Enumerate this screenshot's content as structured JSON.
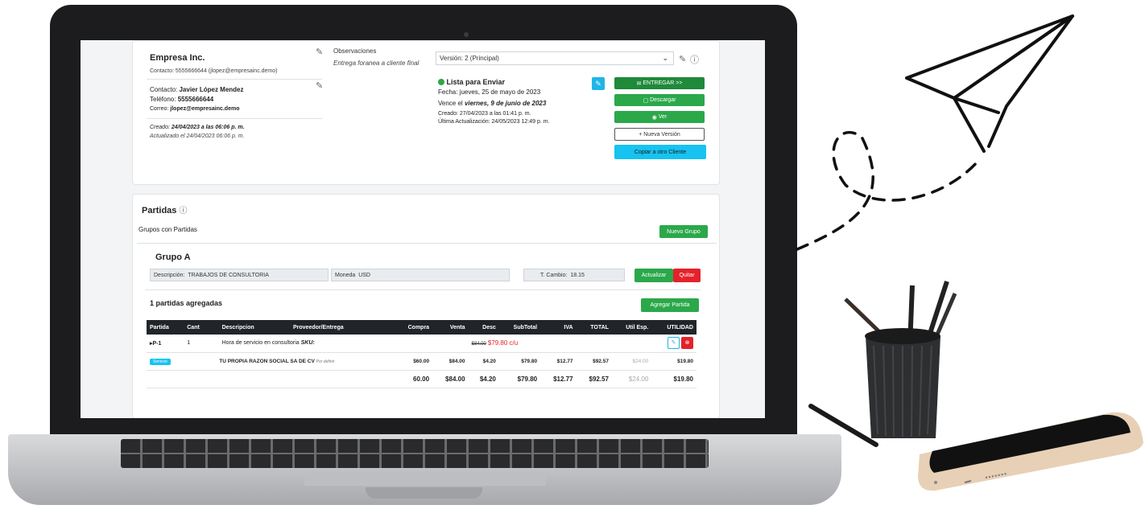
{
  "client": {
    "name": "Empresa Inc.",
    "contact_line": "Contacto: 5555666644 (jlopez@empresainc.demo)",
    "contact_label": "Contacto:",
    "contact_name": "Javier López Mendez",
    "phone_label": "Teléfono:",
    "phone": "5555666644",
    "email_label": "Correo:",
    "email": "jlopez@empresainc.demo",
    "created_prefix": "Creado:",
    "created": "24/04/2023 a las 06:06 p. m.",
    "updated": "Actualizado el 24/04/2023 06:06 p. m."
  },
  "observations": {
    "title": "Observaciones",
    "text": "Entrega foranea a cliente final"
  },
  "version": {
    "selected": "Versión: 2 (Principal)",
    "status": "Lista para Enviar",
    "date": "Fecha: jueves, 25 de mayo de 2023",
    "expires_prefix": "Vence el",
    "expires": "viernes, 9 de junio de 2023",
    "created": "Creado: 27/04/2023 a las 01:41 p. m.",
    "last_update": "Última Actualización: 24/05/2023 12:49 p. m.",
    "status_color": "#2ba84a"
  },
  "actions": {
    "deliver": "ENTREGAR >>",
    "download": "Descargar",
    "view": "Ver",
    "new_version": "Nueva Versión",
    "copy": "Copiar a otro Cliente"
  },
  "parts": {
    "title": "Partidas",
    "groups_label": "Grupos con Partidas",
    "new_group": "Nuevo Grupo",
    "group_name": "Grupo A",
    "desc_label": "Descripción:",
    "desc_value": "TRABAJOS DE CONSULTORIA",
    "currency_label": "Moneda",
    "currency_value": "USD",
    "rate_label": "T. Cambio:",
    "rate_value": "18.15",
    "update": "Actualizar",
    "remove": "Quitar",
    "count_label": "1 partidas agregadas",
    "add_part": "Agregar Partida"
  },
  "table": {
    "headers": [
      "Partida",
      "Cant",
      "Descripcion",
      "Proveedor/Entrega",
      "Compra",
      "Venta",
      "Desc",
      "SubTotal",
      "IVA",
      "TOTAL",
      "Util Esp.",
      "UTILIDAD"
    ],
    "row": {
      "id": "P-1",
      "qty": "1",
      "description": "Hora de servicio en consultoria",
      "sku": "SKU:",
      "old_price": "$84.00",
      "new_price": "$79.80 c/u"
    },
    "provider_row": {
      "badge": "Servicio",
      "provider": "TU PROPIA RAZON SOCIAL SA DE CV",
      "delivery": "Por definir",
      "compra": "$60.00",
      "venta": "$84.00",
      "desc": "$4.20",
      "subtotal": "$79.80",
      "iva": "$12.77",
      "total": "$92.57",
      "util_esp": "$24.00",
      "utilidad": "$19.80"
    },
    "totals": {
      "compra": "60.00",
      "venta": "$84.00",
      "desc": "$4.20",
      "subtotal": "$79.80",
      "iva": "$12.77",
      "total": "$92.57",
      "util_esp": "$24.00",
      "utilidad": "$19.80"
    }
  }
}
